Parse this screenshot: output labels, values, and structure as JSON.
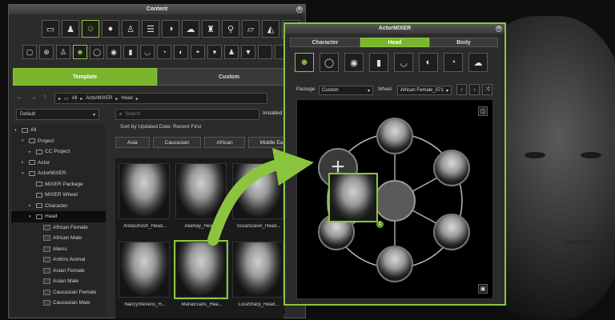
{
  "content": {
    "title": "Content",
    "close": "⊗",
    "tabs": [
      "Template",
      "Custom"
    ],
    "breadcrumb": {
      "all": "All",
      "actormixer": "ActorMIXER",
      "head": "Head"
    },
    "path_dropdown": "Default",
    "search_placeholder": "Search",
    "installed": "Installed",
    "sort_label": "Sort by Updated Date: Recent First",
    "filters": [
      "Asia",
      "Caucasian",
      "African",
      "Middle Ea"
    ],
    "tree": [
      {
        "label": "All",
        "level": 0,
        "arrow": "▾"
      },
      {
        "label": "Project",
        "level": 1,
        "arrow": "▾"
      },
      {
        "label": "CC Project",
        "level": 2,
        "arrow": "▸"
      },
      {
        "label": "Actor",
        "level": 1,
        "arrow": "▸"
      },
      {
        "label": "ActorMIXER",
        "level": 1,
        "arrow": "▾"
      },
      {
        "label": "MIXER Package",
        "level": 2,
        "arrow": ""
      },
      {
        "label": "MIXER Wheel",
        "level": 2,
        "arrow": ""
      },
      {
        "label": "Character",
        "level": 2,
        "arrow": "▸"
      },
      {
        "label": "Head",
        "level": 2,
        "arrow": "▾"
      },
      {
        "label": "African Female",
        "level": 3,
        "arrow": ""
      },
      {
        "label": "African Male",
        "level": 3,
        "arrow": ""
      },
      {
        "label": "Aliens",
        "level": 3,
        "arrow": ""
      },
      {
        "label": "Anthro Animal",
        "level": 3,
        "arrow": ""
      },
      {
        "label": "Asian Female",
        "level": 3,
        "arrow": ""
      },
      {
        "label": "Asian Male",
        "level": 3,
        "arrow": ""
      },
      {
        "label": "Caucasian Female",
        "level": 3,
        "arrow": ""
      },
      {
        "label": "Caucasian Male",
        "level": 3,
        "arrow": ""
      }
    ],
    "cards": [
      "AnitaGhosh_Head...",
      "AliaRay_Head...",
      "SusanDavis_Head...",
      "NancyStevens_H...",
      "MariaEvans_Hea...",
      "LoraSharp_Head..."
    ]
  },
  "mixer": {
    "title": "ActorMIXER",
    "close": "⊗",
    "tabs": [
      "Character",
      "Head",
      "Body"
    ],
    "package_label": "Package",
    "package_value": "Custom",
    "wheel_label": "Wheel",
    "wheel_value": "African Female_071",
    "badge": "1",
    "plus": "+"
  },
  "colors": {
    "accent": "#8bc53f"
  }
}
